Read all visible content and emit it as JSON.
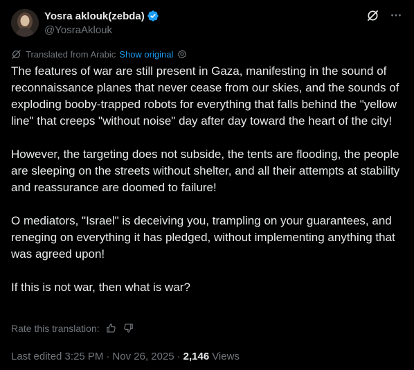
{
  "author": {
    "display_name": "Yosra aklouk(zebda)",
    "handle": "@YosraAklouk",
    "verified": true,
    "verified_color": "#1d9bf0"
  },
  "actions": {
    "grok_icon": "grok-slash-icon",
    "more_icon": "more-dots-icon"
  },
  "translation": {
    "label": "Translated from Arabic",
    "show_original": "Show original",
    "rate_label": "Rate this translation:"
  },
  "body": {
    "paragraphs": [
      "The features of war are still present in Gaza, manifesting in the sound of reconnaissance planes that never cease from our skies, and the sounds of exploding booby-trapped robots for everything that falls behind the \"yellow line\" that creeps \"without noise\" day after day toward the heart of the city!",
      "However, the targeting does not subside, the tents are flooding, the people are sleeping on the streets without shelter, and all their attempts at stability and reassurance are doomed to failure!",
      "O mediators, \"Israel\" is deceiving you, trampling on your guarantees, and reneging on everything it has pledged, without implementing anything that was agreed upon!",
      "If this is not war, then what is war?"
    ]
  },
  "meta": {
    "edited": "Last edited 3:25 PM",
    "date": "Nov 26, 2025",
    "views_count": "2,146",
    "views_label": "Views",
    "separator": "·"
  },
  "colors": {
    "background": "#000000",
    "text": "#e7e9ea",
    "muted": "#71767b",
    "accent": "#1d9bf0"
  }
}
